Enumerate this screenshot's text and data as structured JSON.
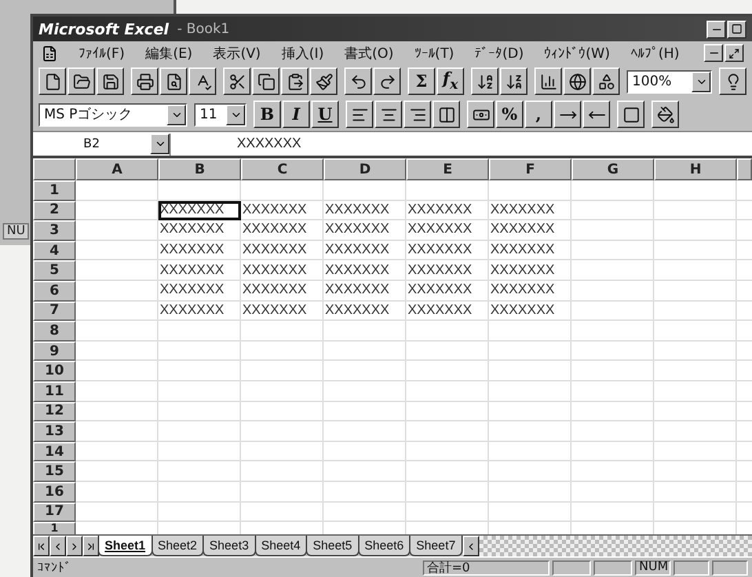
{
  "background_window": {
    "status_text": "NU"
  },
  "window": {
    "app": "Microsoft Excel",
    "document": "- Book1"
  },
  "menu": [
    "ﾌｧｲﾙ(F)",
    "編集(E)",
    "表示(V)",
    "挿入(I)",
    "書式(O)",
    "ﾂｰﾙ(T)",
    "ﾃﾞｰﾀ(D)",
    "ｳｨﾝﾄﾞｳ(W)",
    "ﾍﾙﾌﾟ(H)"
  ],
  "standard_toolbar": {
    "sum": "Σ",
    "function": "f$_{x}$",
    "zoom": "100%"
  },
  "formatting_toolbar": {
    "font": "MS Pゴシック",
    "size": "11",
    "bold": "B",
    "italic": "I",
    "underline": "U",
    "percent": "%",
    "comma": ","
  },
  "formula_bar": {
    "name_box": "B2",
    "content": "XXXXXXX"
  },
  "sheet": {
    "columns": [
      "A",
      "B",
      "C",
      "D",
      "E",
      "F",
      "G",
      "H"
    ],
    "rows": [
      {
        "label": "1",
        "cells": [
          {
            "selected": false
          },
          {
            "selected": false
          },
          {
            "selected": false
          },
          {
            "selected": false
          },
          {
            "selected": false
          },
          {
            "selected": false
          },
          {
            "selected": false
          },
          {
            "selected": false
          }
        ]
      },
      {
        "label": "2",
        "cells": [
          {
            "selected": false
          },
          {
            "text": "XXXXXXX",
            "selected": true
          },
          {
            "text": "XXXXXXX",
            "selected": false
          },
          {
            "text": "XXXXXXX",
            "selected": false
          },
          {
            "text": "XXXXXXX",
            "selected": false
          },
          {
            "text": "XXXXXXX",
            "selected": false
          },
          {
            "selected": false
          },
          {
            "selected": false
          }
        ]
      },
      {
        "label": "3",
        "cells": [
          {
            "selected": false
          },
          {
            "text": "XXXXXXX",
            "selected": false
          },
          {
            "text": "XXXXXXX",
            "selected": false
          },
          {
            "text": "XXXXXXX",
            "selected": false
          },
          {
            "text": "XXXXXXX",
            "selected": false
          },
          {
            "text": "XXXXXXX",
            "selected": false
          },
          {
            "selected": false
          },
          {
            "selected": false
          }
        ]
      },
      {
        "label": "4",
        "cells": [
          {
            "selected": false
          },
          {
            "text": "XXXXXXX",
            "selected": false
          },
          {
            "text": "XXXXXXX",
            "selected": false
          },
          {
            "text": "XXXXXXX",
            "selected": false
          },
          {
            "text": "XXXXXXX",
            "selected": false
          },
          {
            "text": "XXXXXXX",
            "selected": false
          },
          {
            "selected": false
          },
          {
            "selected": false
          }
        ]
      },
      {
        "label": "5",
        "cells": [
          {
            "selected": false
          },
          {
            "text": "XXXXXXX",
            "selected": false
          },
          {
            "text": "XXXXXXX",
            "selected": false
          },
          {
            "text": "XXXXXXX",
            "selected": false
          },
          {
            "text": "XXXXXXX",
            "selected": false
          },
          {
            "text": "XXXXXXX",
            "selected": false
          },
          {
            "selected": false
          },
          {
            "selected": false
          }
        ]
      },
      {
        "label": "6",
        "cells": [
          {
            "selected": false
          },
          {
            "text": "XXXXXXX",
            "selected": false
          },
          {
            "text": "XXXXXXX",
            "selected": false
          },
          {
            "text": "XXXXXXX",
            "selected": false
          },
          {
            "text": "XXXXXXX",
            "selected": false
          },
          {
            "text": "XXXXXXX",
            "selected": false
          },
          {
            "selected": false
          },
          {
            "selected": false
          }
        ]
      },
      {
        "label": "7",
        "cells": [
          {
            "selected": false
          },
          {
            "text": "XXXXXXX",
            "selected": false
          },
          {
            "text": "XXXXXXX",
            "selected": false
          },
          {
            "text": "XXXXXXX",
            "selected": false
          },
          {
            "text": "XXXXXXX",
            "selected": false
          },
          {
            "text": "XXXXXXX",
            "selected": false
          },
          {
            "selected": false
          },
          {
            "selected": false
          }
        ]
      },
      {
        "label": "8",
        "cells": [
          {
            "selected": false
          },
          {
            "selected": false
          },
          {
            "selected": false
          },
          {
            "selected": false
          },
          {
            "selected": false
          },
          {
            "selected": false
          },
          {
            "selected": false
          },
          {
            "selected": false
          }
        ]
      },
      {
        "label": "9",
        "cells": [
          {
            "selected": false
          },
          {
            "selected": false
          },
          {
            "selected": false
          },
          {
            "selected": false
          },
          {
            "selected": false
          },
          {
            "selected": false
          },
          {
            "selected": false
          },
          {
            "selected": false
          }
        ]
      },
      {
        "label": "10",
        "cells": [
          {
            "selected": false
          },
          {
            "selected": false
          },
          {
            "selected": false
          },
          {
            "selected": false
          },
          {
            "selected": false
          },
          {
            "selected": false
          },
          {
            "selected": false
          },
          {
            "selected": false
          }
        ]
      },
      {
        "label": "11",
        "cells": [
          {
            "selected": false
          },
          {
            "selected": false
          },
          {
            "selected": false
          },
          {
            "selected": false
          },
          {
            "selected": false
          },
          {
            "selected": false
          },
          {
            "selected": false
          },
          {
            "selected": false
          }
        ]
      },
      {
        "label": "12",
        "cells": [
          {
            "selected": false
          },
          {
            "selected": false
          },
          {
            "selected": false
          },
          {
            "selected": false
          },
          {
            "selected": false
          },
          {
            "selected": false
          },
          {
            "selected": false
          },
          {
            "selected": false
          }
        ]
      },
      {
        "label": "13",
        "cells": [
          {
            "selected": false
          },
          {
            "selected": false
          },
          {
            "selected": false
          },
          {
            "selected": false
          },
          {
            "selected": false
          },
          {
            "selected": false
          },
          {
            "selected": false
          },
          {
            "selected": false
          }
        ]
      },
      {
        "label": "14",
        "cells": [
          {
            "selected": false
          },
          {
            "selected": false
          },
          {
            "selected": false
          },
          {
            "selected": false
          },
          {
            "selected": false
          },
          {
            "selected": false
          },
          {
            "selected": false
          },
          {
            "selected": false
          }
        ]
      },
      {
        "label": "15",
        "cells": [
          {
            "selected": false
          },
          {
            "selected": false
          },
          {
            "selected": false
          },
          {
            "selected": false
          },
          {
            "selected": false
          },
          {
            "selected": false
          },
          {
            "selected": false
          },
          {
            "selected": false
          }
        ]
      },
      {
        "label": "16",
        "cells": [
          {
            "selected": false
          },
          {
            "selected": false
          },
          {
            "selected": false
          },
          {
            "selected": false
          },
          {
            "selected": false
          },
          {
            "selected": false
          },
          {
            "selected": false
          },
          {
            "selected": false
          }
        ]
      },
      {
        "label": "17",
        "cells": [
          {
            "selected": false
          },
          {
            "selected": false
          },
          {
            "selected": false
          },
          {
            "selected": false
          },
          {
            "selected": false
          },
          {
            "selected": false
          },
          {
            "selected": false
          },
          {
            "selected": false
          }
        ]
      },
      {
        "label": "1",
        "cells": [
          {
            "selected": false
          },
          {
            "selected": false
          },
          {
            "selected": false
          },
          {
            "selected": false
          },
          {
            "selected": false
          },
          {
            "selected": false
          },
          {
            "selected": false
          },
          {
            "selected": false
          }
        ]
      }
    ]
  },
  "sheet_tabs": [
    {
      "label": "Sheet1",
      "selected": true
    },
    {
      "label": "Sheet2",
      "selected": false
    },
    {
      "label": "Sheet3",
      "selected": false
    },
    {
      "label": "Sheet4",
      "selected": false
    },
    {
      "label": "Sheet5",
      "selected": false
    },
    {
      "label": "Sheet6",
      "selected": false
    },
    {
      "label": "Sheet7",
      "selected": false
    }
  ],
  "status_bar": {
    "mode": "ｺﾏﾝﾄﾞ",
    "sum": "合計=0",
    "indicator": "NUM"
  }
}
